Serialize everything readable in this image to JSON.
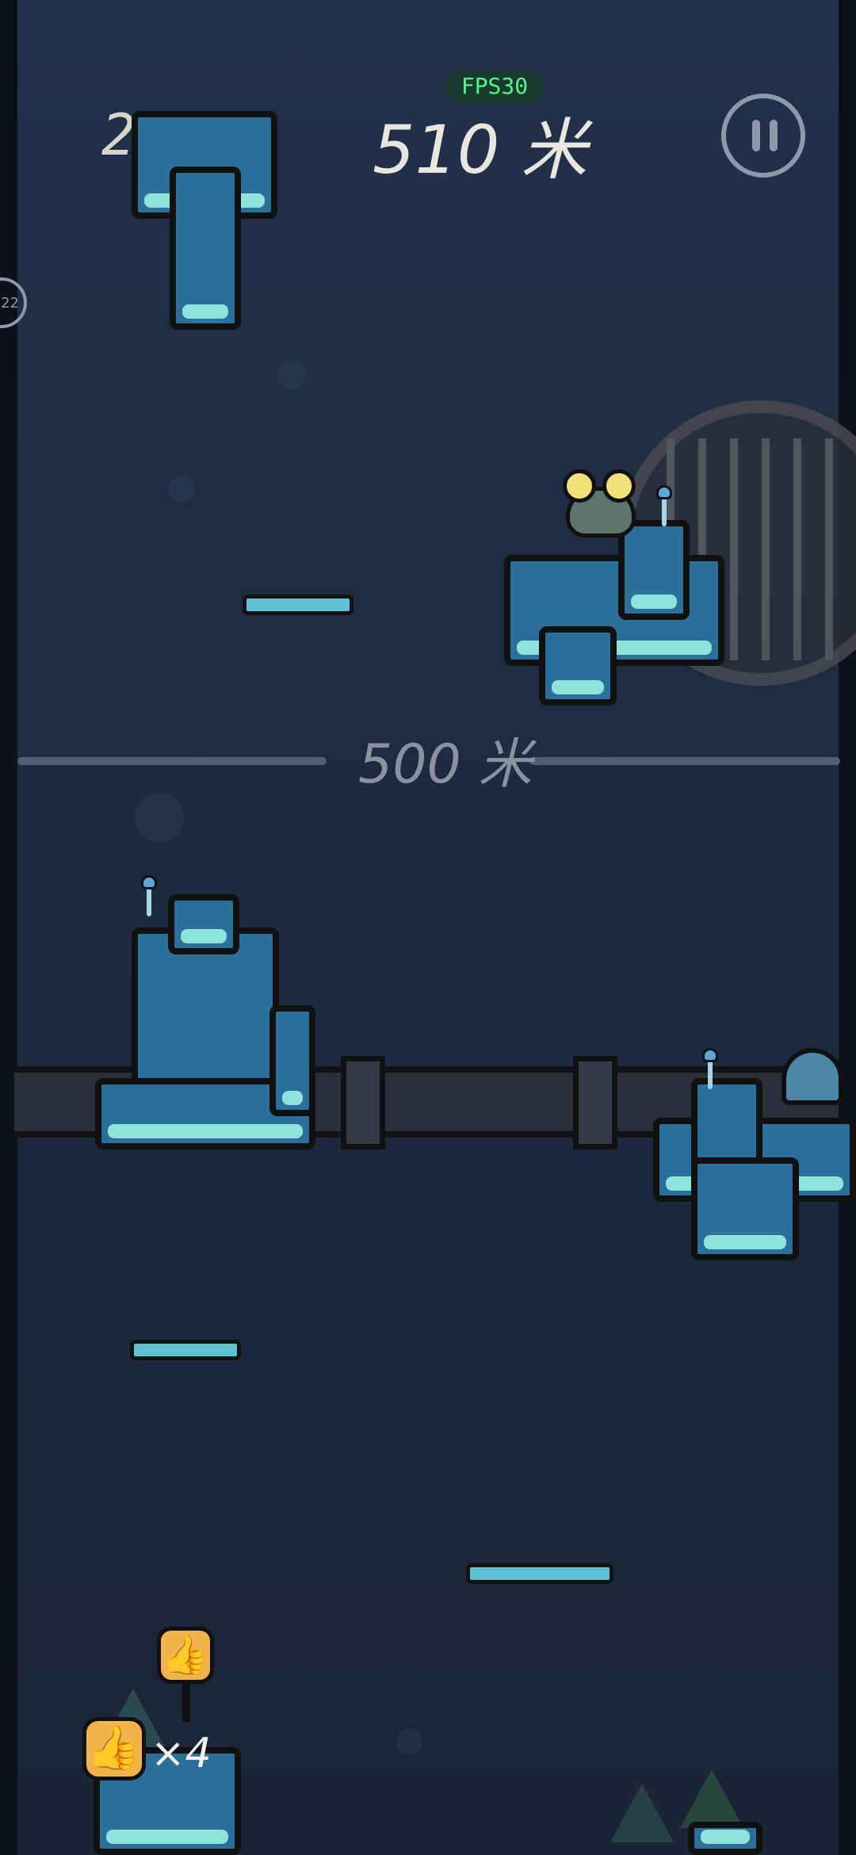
{
  "hud": {
    "time": "26:15",
    "distance": "510 米",
    "fps": "FPS30",
    "side_badge": "22"
  },
  "milestone": {
    "label": "500 米"
  },
  "powerup": {
    "count_label": "×4",
    "icon": "thumbs-up-icon"
  },
  "colors": {
    "background": "#1f2b3f",
    "platform": "#4aa6c8",
    "platform_top": "#8ee3dd",
    "fps_text": "#57f38a",
    "hud_text": "#e8e6df"
  }
}
